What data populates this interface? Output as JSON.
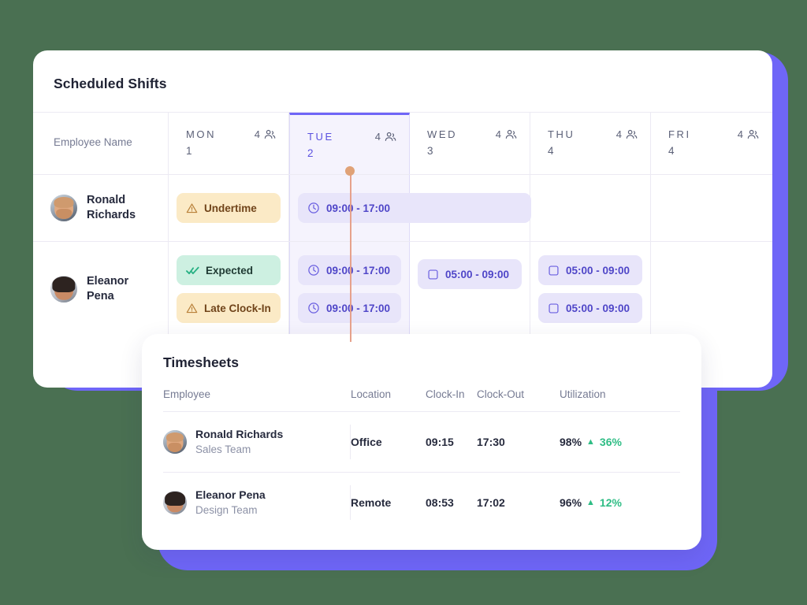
{
  "theme": {
    "page_background": "#4a7052",
    "accent_purple": "#6f66f7",
    "chip_time_bg": "#e8e5fa",
    "chip_time_text": "#4f46c8",
    "chip_warn_bg": "#fbeac6",
    "chip_warn_text": "#70441a",
    "chip_ok_bg": "#cdf0e1",
    "positive_green": "#2fbd85",
    "time_marker": "#e6a18b"
  },
  "shifts": {
    "title": "Scheduled Shifts",
    "employee_column_header": "Employee Name",
    "days": [
      {
        "dow": "MON",
        "date": "1",
        "count": "4",
        "icon": "people-icon",
        "active": false
      },
      {
        "dow": "TUE",
        "date": "2",
        "count": "4",
        "icon": "people-icon",
        "active": true
      },
      {
        "dow": "WED",
        "date": "3",
        "count": "4",
        "icon": "people-icon",
        "active": false
      },
      {
        "dow": "THU",
        "date": "4",
        "count": "4",
        "icon": "people-icon",
        "active": false
      },
      {
        "dow": "FRI",
        "date": "4",
        "count": "4",
        "icon": "people-icon",
        "active": false
      }
    ],
    "rows": [
      {
        "name_line1": "Ronald",
        "name_line2": "Richards",
        "avatar": "avatar-ronald",
        "mon": {
          "label": "Undertime",
          "icon": "warning-triangle-icon",
          "style": "warn"
        },
        "tue_span": {
          "label": "09:00 - 17:00",
          "icon": "clock-icon",
          "style": "time"
        }
      },
      {
        "name_line1": "Eleanor",
        "name_line2": "Pena",
        "avatar": "avatar-eleanor",
        "mon": [
          {
            "label": "Expected",
            "icon": "double-check-icon",
            "style": "ok"
          },
          {
            "label": "Late Clock-In",
            "icon": "warning-triangle-icon",
            "style": "warn"
          }
        ],
        "tue": [
          {
            "label": "09:00 - 17:00",
            "icon": "clock-icon",
            "style": "time"
          },
          {
            "label": "09:00 - 17:00",
            "icon": "clock-icon",
            "style": "time"
          }
        ],
        "wed": [
          {
            "label": "05:00 - 09:00",
            "icon": "square-icon",
            "style": "time"
          }
        ],
        "thu": [
          {
            "label": "05:00 - 09:00",
            "icon": "square-icon",
            "style": "time"
          },
          {
            "label": "05:00 - 09:00",
            "icon": "square-icon",
            "style": "time"
          }
        ],
        "fri": []
      }
    ]
  },
  "timesheets": {
    "title": "Timesheets",
    "columns": {
      "employee": "Employee",
      "location": "Location",
      "clock_in": "Clock-In",
      "clock_out": "Clock-Out",
      "utilization": "Utilization"
    },
    "rows": [
      {
        "name": "Ronald Richards",
        "team": "Sales Team",
        "avatar": "avatar-ronald",
        "location": "Office",
        "clock_in": "09:15",
        "clock_out": "17:30",
        "utilization": "98%",
        "delta": "36%",
        "delta_direction": "up"
      },
      {
        "name": "Eleanor Pena",
        "team": "Design Team",
        "avatar": "avatar-eleanor",
        "location": "Remote",
        "clock_in": "08:53",
        "clock_out": "17:02",
        "utilization": "96%",
        "delta": "12%",
        "delta_direction": "up"
      }
    ]
  }
}
